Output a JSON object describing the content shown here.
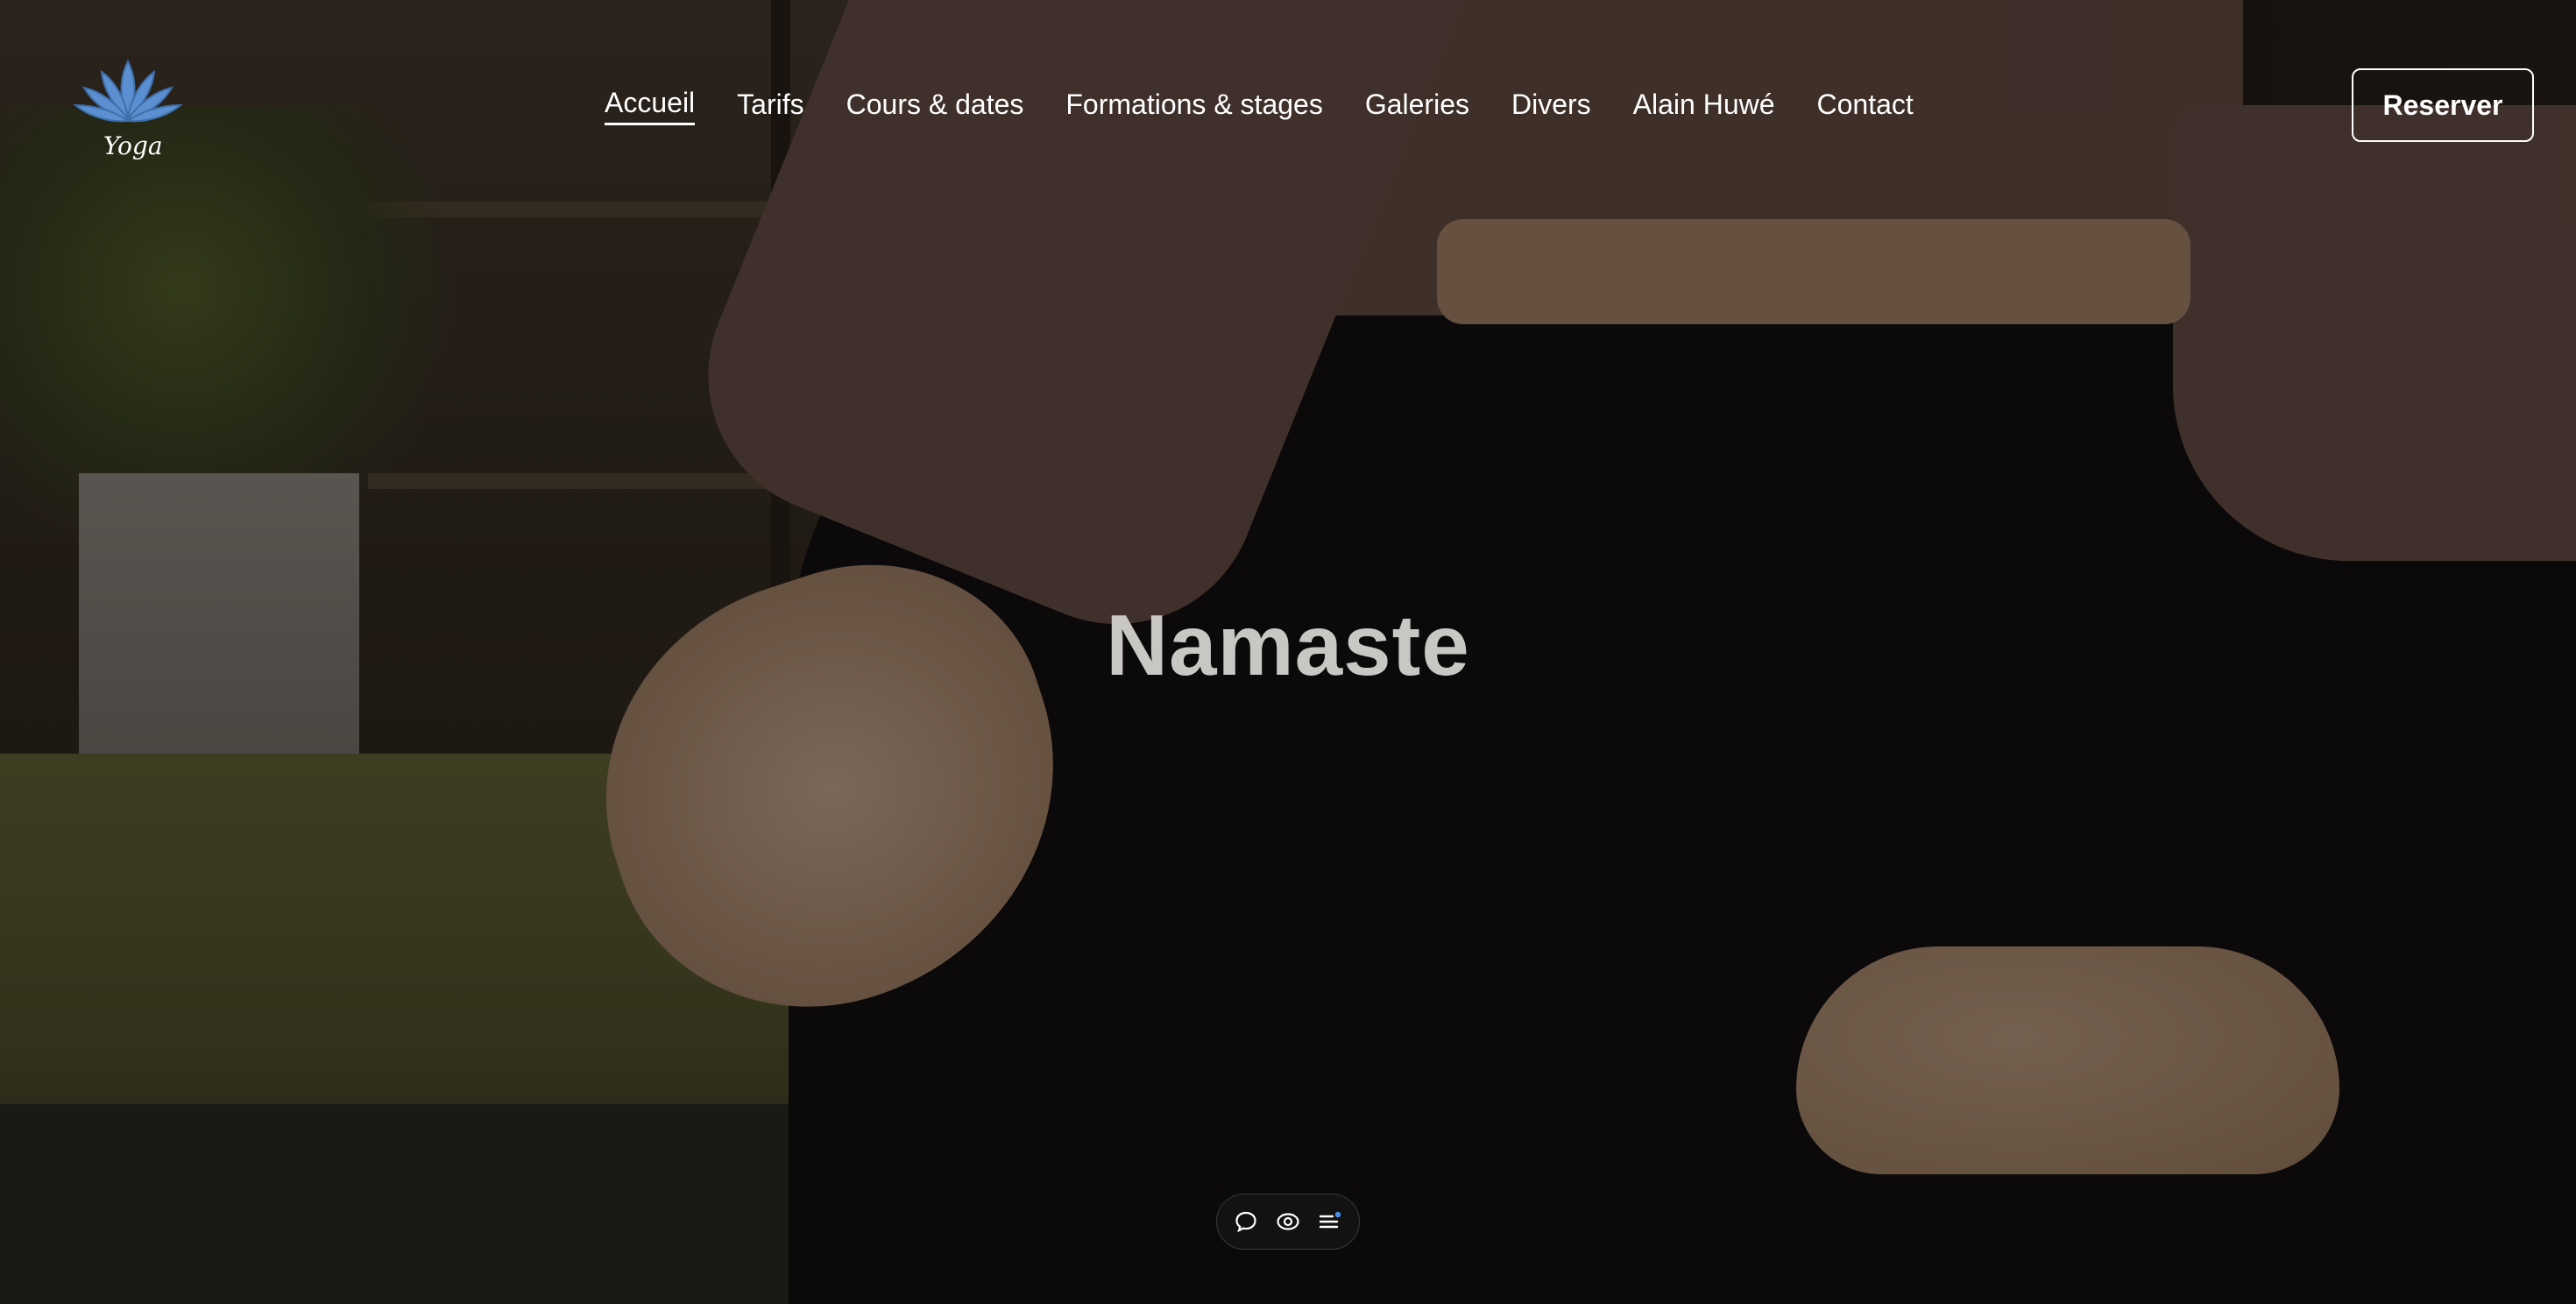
{
  "brand": {
    "logo_text": "Yoga",
    "logo_color": "#5b8fd1"
  },
  "nav": {
    "items": [
      {
        "label": "Accueil",
        "active": true
      },
      {
        "label": "Tarifs"
      },
      {
        "label": "Cours & dates"
      },
      {
        "label": "Formations & stages"
      },
      {
        "label": "Galeries"
      },
      {
        "label": "Divers"
      },
      {
        "label": "Alain Huwé"
      },
      {
        "label": "Contact"
      }
    ]
  },
  "header": {
    "reserve_label": "Reserver"
  },
  "hero": {
    "title": "Namaste"
  },
  "toolbar": {
    "icons": [
      "comment-icon",
      "eye-icon",
      "menu-list-icon"
    ],
    "accent": "#4a90e2"
  }
}
